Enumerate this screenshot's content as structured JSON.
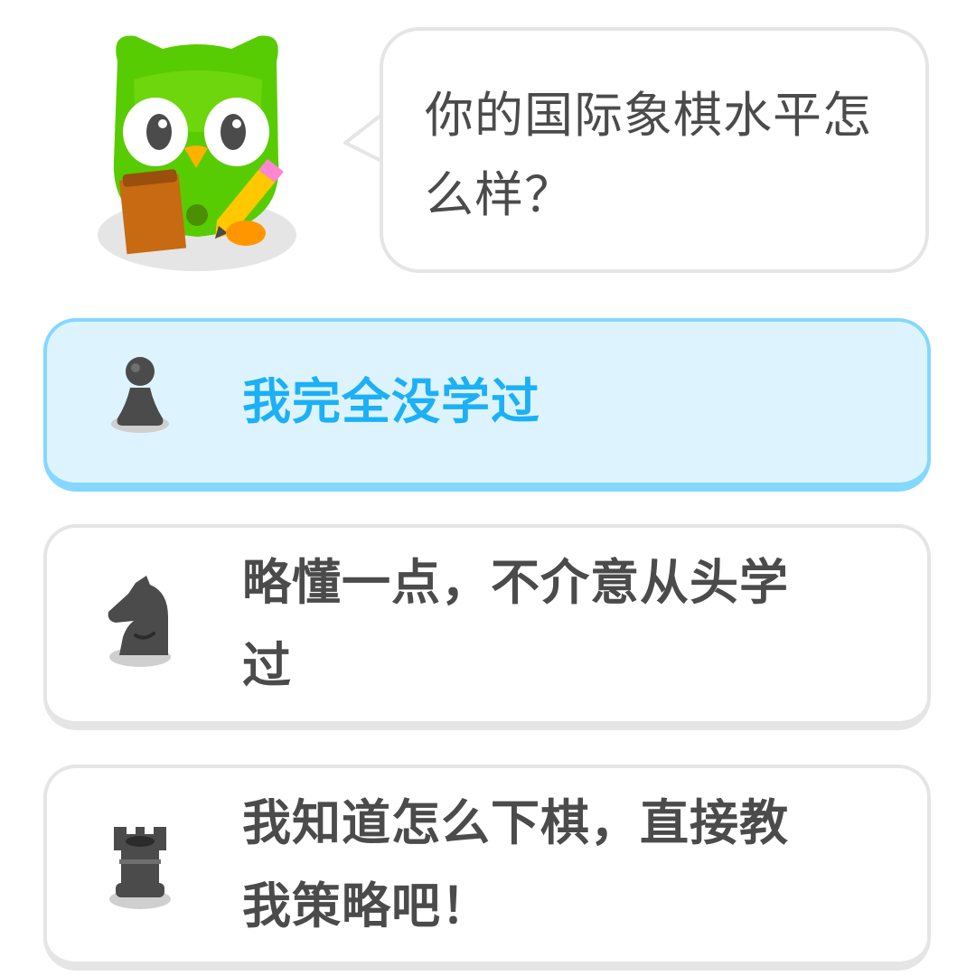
{
  "prompt": {
    "question": "你的国际象棋水平怎么样？",
    "mascot": "duolingo-owl-mascot"
  },
  "options": [
    {
      "label": "我完全没学过",
      "icon": "chess-pawn-icon",
      "selected": true
    },
    {
      "label": "略懂一点，不介意从头学过",
      "icon": "chess-knight-icon",
      "selected": false
    },
    {
      "label": "我知道怎么下棋，直接教我策略吧！",
      "icon": "chess-rook-icon",
      "selected": false
    }
  ],
  "colors": {
    "selected_background": "#ddf4ff",
    "selected_border": "#84d8ff",
    "selected_text": "#1cb0f6",
    "text": "#4b4b4b",
    "border": "#e5e5e5",
    "owl_green": "#58cc02"
  }
}
